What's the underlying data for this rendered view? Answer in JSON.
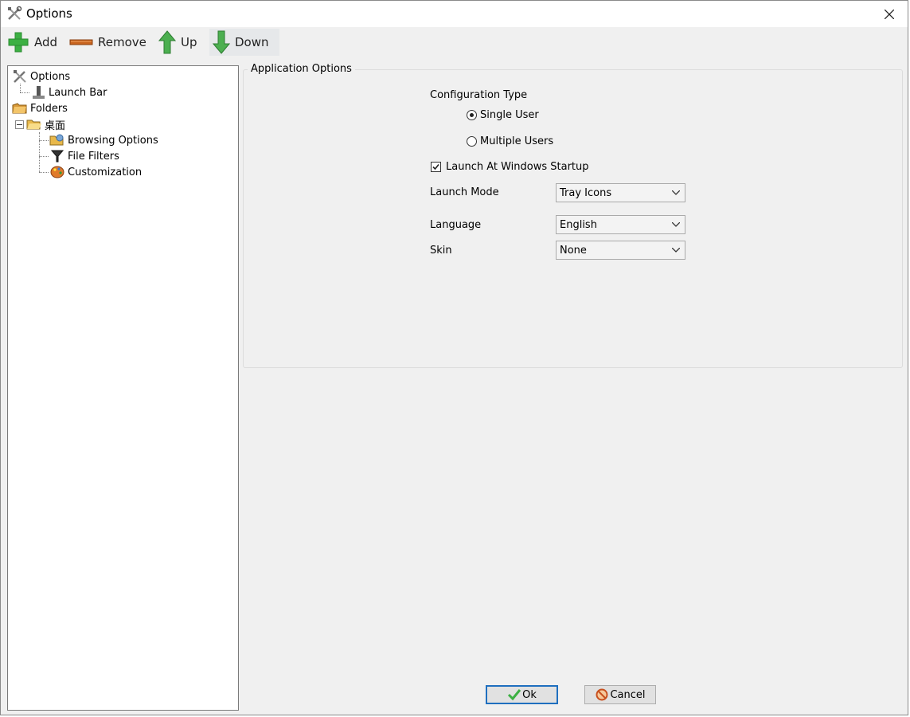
{
  "window": {
    "title": "Options"
  },
  "toolbar": {
    "add_label": "Add",
    "remove_label": "Remove",
    "up_label": "Up",
    "down_label": "Down"
  },
  "tree": {
    "options": "Options",
    "launch_bar": "Launch Bar",
    "folders": "Folders",
    "desktop": "桌面",
    "browsing_options": "Browsing Options",
    "file_filters": "File Filters",
    "customization": "Customization"
  },
  "app_options": {
    "group_title": "Application Options",
    "config_type_label": "Configuration Type",
    "single_user_label": "Single User",
    "multiple_users_label": "Multiple Users",
    "config_type_selected": "Single User",
    "launch_startup_label": "Launch At Windows Startup",
    "launch_startup_checked": true,
    "launch_mode_label": "Launch Mode",
    "launch_mode_value": "Tray Icons",
    "language_label": "Language",
    "language_value": "English",
    "skin_label": "Skin",
    "skin_value": "None"
  },
  "footer": {
    "ok_label": "Ok",
    "cancel_label": "Cancel"
  },
  "colors": {
    "add_green": "#3cb043",
    "arrow_green": "#4caf50",
    "remove_orange": "#c8641e",
    "default_button_border": "#1f6fbf"
  }
}
